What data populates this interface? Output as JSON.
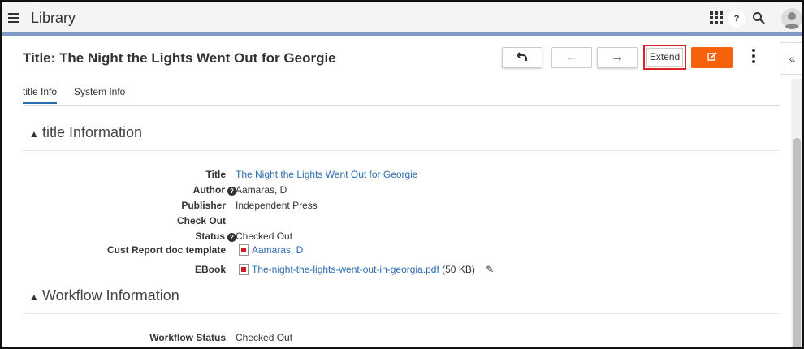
{
  "app": {
    "title": "Library"
  },
  "topbar": {
    "help_glyph": "?",
    "icons": [
      "hamburger-icon",
      "apps-grid-icon",
      "help-icon",
      "search-icon",
      "user-avatar-icon"
    ]
  },
  "header": {
    "title": "Title: The Night the Lights Went Out for Georgie",
    "extend_label": "Extend",
    "collapse_glyph": "«"
  },
  "tabs": [
    {
      "label": "title Info",
      "active": true
    },
    {
      "label": "System Info",
      "active": false
    }
  ],
  "sections": {
    "title_info": {
      "heading": "title Information",
      "fields": {
        "title": {
          "label": "Title",
          "value": "The Night the Lights Went Out for Georgie"
        },
        "author": {
          "label": "Author",
          "value": "Aamaras, D"
        },
        "publisher": {
          "label": "Publisher",
          "value": "Independent Press"
        },
        "checkout": {
          "label": "Check Out",
          "value": ""
        },
        "status": {
          "label": "Status",
          "value": "Checked Out"
        },
        "cust_report": {
          "label": "Cust Report doc template",
          "value": "Aamaras, D"
        },
        "ebook": {
          "label": "EBook",
          "value": "The-night-the-lights-went-out-in-georgia.pdf",
          "size": "(50 KB)"
        }
      }
    },
    "workflow_info": {
      "heading": "Workflow Information",
      "fields": {
        "workflow_status": {
          "label": "Workflow Status",
          "value": "Checked Out"
        }
      }
    }
  },
  "colors": {
    "accent": "#2b6cb0",
    "edit_button": "#f6610c",
    "highlight_border": "#d9222a",
    "topbar_border": "#7f9ac4"
  }
}
